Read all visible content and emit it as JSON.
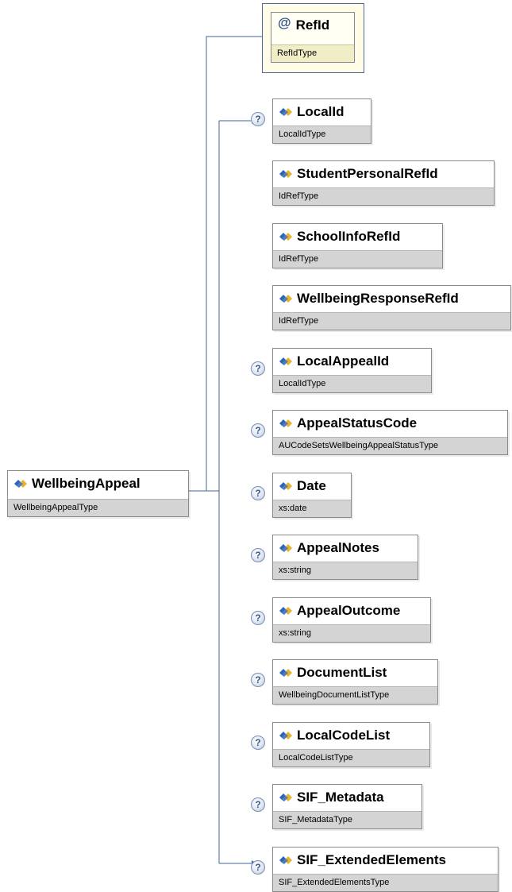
{
  "root": {
    "name": "WellbeingAppeal",
    "type": "WellbeingAppealType"
  },
  "attribute": {
    "symbol": "@",
    "name": "RefId",
    "type": "RefIdType"
  },
  "elements": [
    {
      "name": "LocalId",
      "type": "LocalIdType",
      "optional": true
    },
    {
      "name": "StudentPersonalRefId",
      "type": "IdRefType",
      "optional": false
    },
    {
      "name": "SchoolInfoRefId",
      "type": "IdRefType",
      "optional": false
    },
    {
      "name": "WellbeingResponseRefId",
      "type": "IdRefType",
      "optional": false
    },
    {
      "name": "LocalAppealId",
      "type": "LocalIdType",
      "optional": true
    },
    {
      "name": "AppealStatusCode",
      "type": "AUCodeSetsWellbeingAppealStatusType",
      "optional": true
    },
    {
      "name": "Date",
      "type": "xs:date",
      "optional": true
    },
    {
      "name": "AppealNotes",
      "type": "xs:string",
      "optional": true
    },
    {
      "name": "AppealOutcome",
      "type": "xs:string",
      "optional": true
    },
    {
      "name": "DocumentList",
      "type": "WellbeingDocumentListType",
      "optional": true
    },
    {
      "name": "LocalCodeList",
      "type": "LocalCodeListType",
      "optional": true
    },
    {
      "name": "SIF_Metadata",
      "type": "SIF_MetadataType",
      "optional": true
    },
    {
      "name": "SIF_ExtendedElements",
      "type": "SIF_ExtendedElementsType",
      "optional": true
    }
  ],
  "optional_marker": "?",
  "colors": {
    "connector": "#3f6595",
    "type_band": "#d4d4d4",
    "attribute_band": "#f1eec7",
    "icon_blue": "#2f65b4",
    "icon_gold": "#e9b22b"
  }
}
